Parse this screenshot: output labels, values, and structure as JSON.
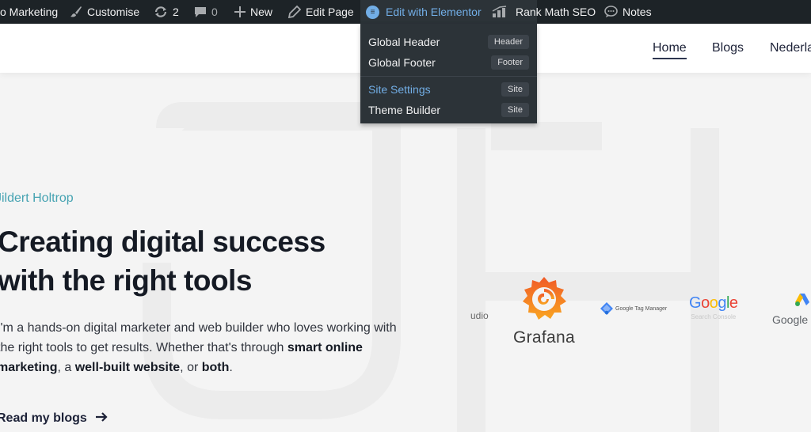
{
  "adminbar": {
    "site": "o Marketing",
    "customise": "Customise",
    "updates_count": "2",
    "comments_count": "0",
    "new": "New",
    "edit_page": "Edit Page",
    "edit_elementor": "Edit with Elementor",
    "rank_math": "Rank Math SEO",
    "notes": "Notes"
  },
  "elementor_menu": {
    "items": [
      {
        "label": "Global Header",
        "tag": "Header"
      },
      {
        "label": "Global Footer",
        "tag": "Footer"
      },
      {
        "label": "Site Settings",
        "tag": "Site"
      },
      {
        "label": "Theme Builder",
        "tag": "Site"
      }
    ]
  },
  "nav": {
    "home": "Home",
    "blogs": "Blogs",
    "ned": "Nederla"
  },
  "hero": {
    "kicker": "Jildert Holtrop",
    "headline_1": "Creating digital success",
    "headline_2": "with the right tools",
    "para_1": "I'm a hands-on digital marketer and web builder who loves working with the right tools to get results. Whether that's through ",
    "para_b1": "smart online marketing",
    "para_2": ", a ",
    "para_b2": "well-built website",
    "para_3": ", or ",
    "para_b3": "both",
    "para_4": ".",
    "read_more": "Read my blogs"
  },
  "logos": {
    "studio": "udio",
    "grafana": "Grafana",
    "gtm": "Google Tag Manager",
    "google": "Google",
    "search_console": "Search Console",
    "google_ads": "Google"
  },
  "colors": {
    "adminbar_bg": "#1d2327",
    "dropdown_bg": "#2c3338",
    "admin_link_blue": "#72aee6",
    "kicker_teal": "#46a3b2",
    "heading_dark": "#151a24"
  },
  "icons": {
    "customise": "paintbrush-icon",
    "updates": "refresh-icon",
    "comments": "speech-bubble-icon",
    "new": "plus-icon",
    "edit": "pencil-icon",
    "elementor": "elementor-logo-icon",
    "rank_math": "rank-math-icon",
    "notes": "notes-bubble-icon",
    "read_more": "arrow-right-icon"
  }
}
